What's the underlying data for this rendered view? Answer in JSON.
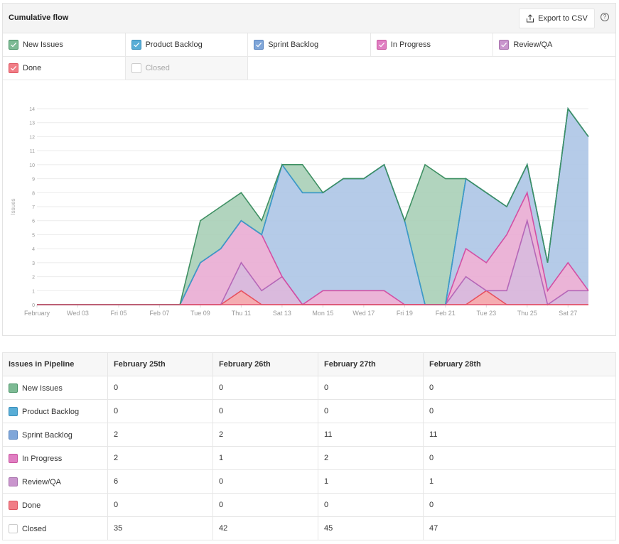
{
  "header": {
    "title": "Cumulative flow",
    "export_label": "Export to CSV",
    "export_icon": "share-upload-icon",
    "help_icon": "question-circle-icon",
    "help_glyph": "?"
  },
  "legend": [
    {
      "label": "New Issues",
      "checked": true,
      "color": "#7dba94",
      "border": "#4a9467"
    },
    {
      "label": "Product Backlog",
      "checked": true,
      "color": "#58add6",
      "border": "#3a8fbb"
    },
    {
      "label": "Sprint Backlog",
      "checked": true,
      "color": "#7fa6d9",
      "border": "#5b86c0"
    },
    {
      "label": "In Progress",
      "checked": true,
      "color": "#e07ec2",
      "border": "#c9559f"
    },
    {
      "label": "Review/QA",
      "checked": true,
      "color": "#c995cd",
      "border": "#a873ad"
    },
    {
      "label": "Done",
      "checked": true,
      "color": "#f17d86",
      "border": "#dd5561"
    },
    {
      "label": "Closed",
      "checked": false,
      "color": "#ffffff",
      "border": "#cccccc"
    }
  ],
  "chart_data": {
    "type": "area",
    "stacked": true,
    "title": "Cumulative flow",
    "xlabel": "",
    "ylabel": "Issues",
    "ylim": [
      0,
      14
    ],
    "yticks": [
      "0",
      "1",
      "2",
      "3",
      "4",
      "5",
      "6",
      "7",
      "8",
      "9",
      "10",
      "11",
      "12",
      "13",
      "14"
    ],
    "xtick_labels": [
      "February",
      "Wed 03",
      "Fri 05",
      "Feb 07",
      "Tue 09",
      "Thu 11",
      "Sat 13",
      "Mon 15",
      "Wed 17",
      "Fri 19",
      "Feb 21",
      "Tue 23",
      "Thu 25",
      "Sat 27"
    ],
    "xtick_days": [
      1,
      3,
      5,
      7,
      9,
      11,
      13,
      15,
      17,
      19,
      21,
      23,
      25,
      27
    ],
    "x_days": [
      1,
      2,
      3,
      4,
      5,
      6,
      7,
      8,
      9,
      10,
      11,
      12,
      13,
      14,
      15,
      16,
      17,
      18,
      19,
      20,
      21,
      22,
      23,
      24,
      25,
      26,
      27,
      28
    ],
    "grid": true,
    "series": [
      {
        "name": "Done",
        "fill": "#f4a3a8",
        "stroke": "#e8505e",
        "values": [
          0,
          0,
          0,
          0,
          0,
          0,
          0,
          0,
          0,
          0,
          1,
          0,
          0,
          0,
          0,
          0,
          0,
          0,
          0,
          0,
          0,
          0,
          1,
          0,
          0,
          0,
          0,
          0
        ]
      },
      {
        "name": "Review/QA",
        "fill": "#d6b3d9",
        "stroke": "#b567b8",
        "values": [
          0,
          0,
          0,
          0,
          0,
          0,
          0,
          0,
          0,
          0,
          2,
          1,
          2,
          0,
          0,
          0,
          0,
          0,
          0,
          0,
          0,
          2,
          0,
          1,
          6,
          0,
          1,
          1
        ]
      },
      {
        "name": "In Progress",
        "fill": "#e9acd3",
        "stroke": "#d34fa4",
        "values": [
          0,
          0,
          0,
          0,
          0,
          0,
          0,
          0,
          3,
          4,
          3,
          4,
          0,
          0,
          1,
          1,
          1,
          1,
          0,
          0,
          0,
          2,
          2,
          4,
          2,
          1,
          2,
          0
        ]
      },
      {
        "name": "Sprint Backlog",
        "fill": "#adc5e6",
        "stroke": "#3f7fc1",
        "values": [
          0,
          0,
          0,
          0,
          0,
          0,
          0,
          0,
          0,
          0,
          0,
          0,
          8,
          8,
          7,
          8,
          8,
          9,
          6,
          0,
          0,
          5,
          5,
          2,
          2,
          2,
          11,
          11
        ]
      },
      {
        "name": "Product Backlog",
        "fill": "#a7d3e8",
        "stroke": "#3d9bc8",
        "values": [
          0,
          0,
          0,
          0,
          0,
          0,
          0,
          0,
          0,
          0,
          0,
          0,
          0,
          0,
          0,
          0,
          0,
          0,
          0,
          0,
          0,
          0,
          0,
          0,
          0,
          0,
          0,
          0
        ]
      },
      {
        "name": "New Issues",
        "fill": "#a9cfb7",
        "stroke": "#3f9063",
        "values": [
          0,
          0,
          0,
          0,
          0,
          0,
          0,
          0,
          3,
          3,
          2,
          1,
          0,
          2,
          0,
          0,
          0,
          0,
          0,
          10,
          9,
          0,
          0,
          0,
          0,
          0,
          0,
          0
        ]
      }
    ]
  },
  "table": {
    "header": [
      "Issues in Pipeline",
      "February 25th",
      "February 26th",
      "February 27th",
      "February 28th"
    ],
    "rows": [
      {
        "label": "New Issues",
        "color": "#7dba94",
        "border": "#4a9467",
        "values": [
          "0",
          "0",
          "0",
          "0"
        ]
      },
      {
        "label": "Product Backlog",
        "color": "#58add6",
        "border": "#3a8fbb",
        "values": [
          "0",
          "0",
          "0",
          "0"
        ]
      },
      {
        "label": "Sprint Backlog",
        "color": "#7fa6d9",
        "border": "#5b86c0",
        "values": [
          "2",
          "2",
          "11",
          "11"
        ]
      },
      {
        "label": "In Progress",
        "color": "#e07ec2",
        "border": "#c9559f",
        "values": [
          "2",
          "1",
          "2",
          "0"
        ]
      },
      {
        "label": "Review/QA",
        "color": "#c995cd",
        "border": "#a873ad",
        "values": [
          "6",
          "0",
          "1",
          "1"
        ]
      },
      {
        "label": "Done",
        "color": "#f17d86",
        "border": "#dd5561",
        "values": [
          "0",
          "0",
          "0",
          "0"
        ]
      },
      {
        "label": "Closed",
        "color": "#ffffff",
        "border": "#cccccc",
        "values": [
          "35",
          "42",
          "45",
          "47"
        ]
      }
    ]
  }
}
